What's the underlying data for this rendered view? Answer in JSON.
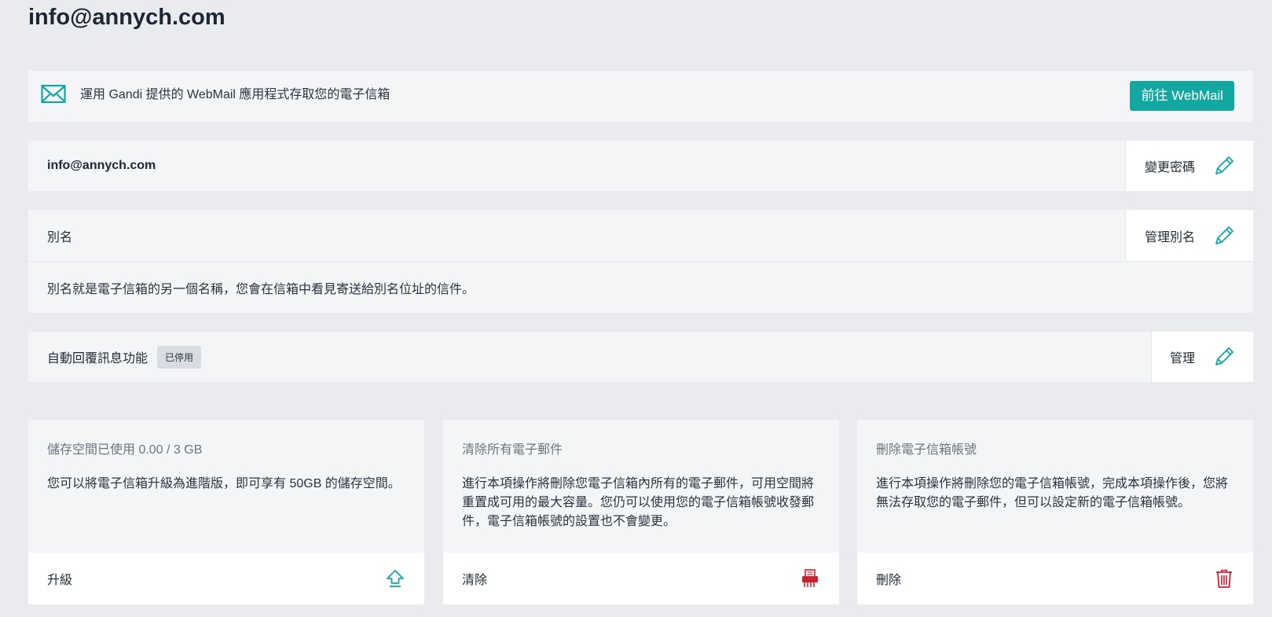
{
  "page": {
    "title": "info@annych.com"
  },
  "webmail": {
    "description": "運用 Gandi 提供的 WebMail 應用程式存取您的電子信箱",
    "button_label": "前往 WebMail",
    "icon": "envelope-icon"
  },
  "account": {
    "email": "info@annych.com",
    "action_label": "變更密碼",
    "icon": "pencil-icon"
  },
  "alias": {
    "label": "別名",
    "action_label": "管理別名",
    "description": "別名就是電子信箱的另一個名稱，您會在信箱中看見寄送給別名位址的信件。"
  },
  "autoreply": {
    "label": "自動回覆訊息功能",
    "status_badge": "已停用",
    "action_label": "管理"
  },
  "cards": {
    "storage": {
      "title": "儲存空間已使用 0.00 / 3 GB",
      "body": "您可以將電子信箱升級為進階版，即可享有 50GB 的儲存空間。",
      "action_label": "升級",
      "icon": "upgrade-arrow-icon"
    },
    "purge": {
      "title": "清除所有電子郵件",
      "body": "進行本項操作將刪除您電子信箱內所有的電子郵件，可用空間將重置成可用的最大容量。您仍可以使用您的電子信箱帳號收發郵件，電子信箱帳號的設置也不會變更。",
      "action_label": "清除",
      "icon": "shredder-icon"
    },
    "delete": {
      "title": "刪除電子信箱帳號",
      "body": "進行本項操作將刪除您的電子信箱帳號，完成本項操作後，您將無法存取您的電子郵件，但可以設定新的電子信箱帳號。",
      "action_label": "刪除",
      "icon": "trash-icon"
    }
  },
  "colors": {
    "accent": "#13a7a1",
    "danger": "#d0202e",
    "background": "#e9ebee",
    "panel": "#f4f5f7"
  }
}
